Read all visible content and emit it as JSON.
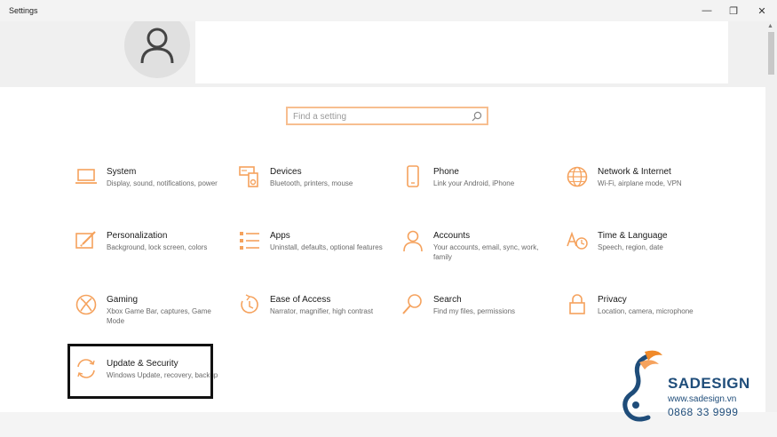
{
  "window": {
    "title": "Settings",
    "minimize_glyph": "—",
    "maximize_glyph": "❐",
    "close_glyph": "✕"
  },
  "search": {
    "placeholder": "Find a setting"
  },
  "accent_color": "#f5a25d",
  "tiles": [
    {
      "name": "System",
      "desc": "Display, sound, notifications, power",
      "icon": "laptop-icon"
    },
    {
      "name": "Devices",
      "desc": "Bluetooth, printers, mouse",
      "icon": "keyboard-speaker-icon"
    },
    {
      "name": "Phone",
      "desc": "Link your Android, iPhone",
      "icon": "phone-icon"
    },
    {
      "name": "Network & Internet",
      "desc": "Wi-Fi, airplane mode, VPN",
      "icon": "globe-icon"
    },
    {
      "name": "Personalization",
      "desc": "Background, lock screen, colors",
      "icon": "paint-icon"
    },
    {
      "name": "Apps",
      "desc": "Uninstall, defaults, optional features",
      "icon": "apps-list-icon"
    },
    {
      "name": "Accounts",
      "desc": "Your accounts, email, sync, work, family",
      "icon": "person-icon"
    },
    {
      "name": "Time & Language",
      "desc": "Speech, region, date",
      "icon": "time-language-icon"
    },
    {
      "name": "Gaming",
      "desc": "Xbox Game Bar, captures, Game Mode",
      "icon": "xbox-icon"
    },
    {
      "name": "Ease of Access",
      "desc": "Narrator, magnifier, high contrast",
      "icon": "ease-of-access-icon"
    },
    {
      "name": "Search",
      "desc": "Find my files, permissions",
      "icon": "search-icon"
    },
    {
      "name": "Privacy",
      "desc": "Location, camera, microphone",
      "icon": "lock-icon"
    },
    {
      "name": "Update & Security",
      "desc": "Windows Update, recovery, backup",
      "icon": "sync-icon"
    }
  ],
  "watermark": {
    "brand": "SADESIGN",
    "url": "www.sadesign.vn",
    "phone": "0868 33 9999"
  }
}
